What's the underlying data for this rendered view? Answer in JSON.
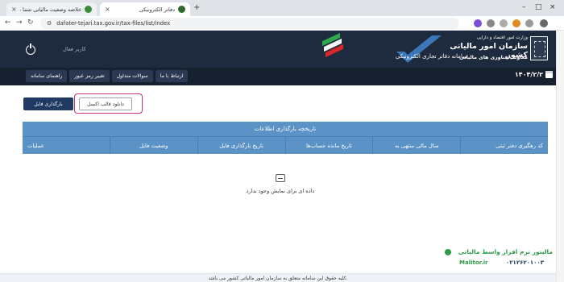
{
  "browser": {
    "tabs": [
      {
        "title": "خلاصه وضعیت مالیاتی شما در ..."
      },
      {
        "title": "دفاتر الکترونیکی"
      }
    ],
    "url": "dafater-tejari.tax.gov.ir/tax-files/list/index"
  },
  "header": {
    "username": "کاربر فعال",
    "org_top": "وزارت امور اقتصاد و دارایی",
    "org_main": "سازمان امور مالیاتی کشور",
    "org_bottom": "معاونت فناوری های مالیاتی",
    "system_name": "سامانه دفاتر تجاری الکترونیکی"
  },
  "nav": {
    "buttons": [
      "راهنمای سامانه",
      "تغییر رمز عبور",
      "سوالات متداول",
      "ارتباط با ما"
    ],
    "date": "۱۴۰۴/۲/۲"
  },
  "actions": {
    "upload_label": "بارگذاری فایل",
    "excel_label": "دانلود قالب اکسل"
  },
  "table": {
    "title": "تاریخچه بارگذاری اطلاعات",
    "columns": [
      "کد رهگیری دفتر ثبتی",
      "سال مالی منتهی به",
      "تاریخ مانده حساب‌ها",
      "تاریخ بارگذاری فایل",
      "وضعیت فایل",
      "عملیات"
    ],
    "empty_message": "داده ای برای نمایش وجود ندارد"
  },
  "brand": {
    "name": "مالیتور نرم افزار واسط مالیاتی",
    "site": "Malitor.ir",
    "phone": "۰۲۱۲۶۲۰۱۰۰۳"
  },
  "footer": {
    "text": "کلیه حقوق این سامانه متعلق به سازمان امور مالیاتی کشور می باشد."
  },
  "colors": {
    "header_bg": "#1e2a3d",
    "nav_bg": "#16202e",
    "table_header": "#5b93c7",
    "primary_button": "#1f3a63",
    "highlight": "#c5317f",
    "brand_green": "#2e9b48"
  }
}
